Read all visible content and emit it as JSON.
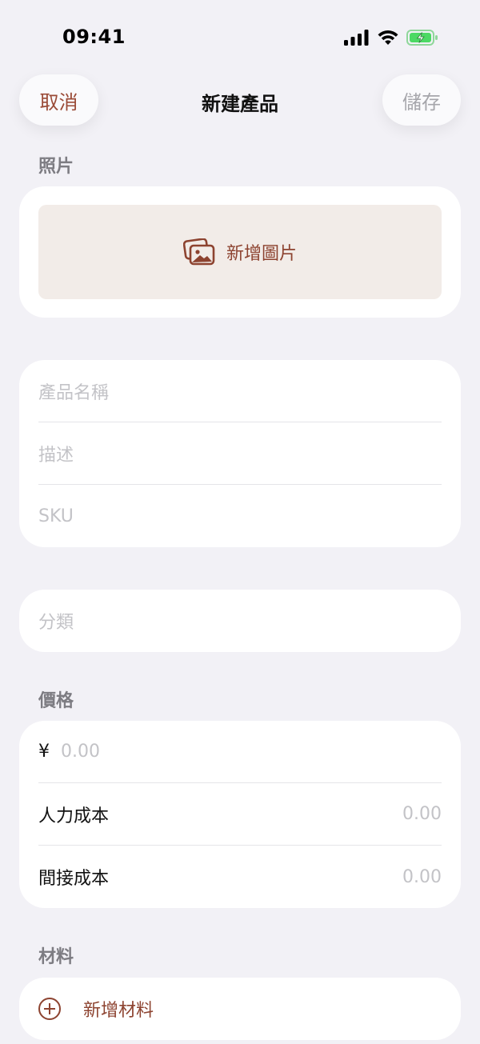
{
  "status_bar": {
    "time": "09:41",
    "icons": [
      "cellular-signal-icon",
      "wifi-icon",
      "battery-charging-icon"
    ]
  },
  "nav": {
    "cancel_label": "取消",
    "title": "新建產品",
    "save_label": "儲存"
  },
  "photos": {
    "section_label": "照片",
    "add_image_label": "新增圖片",
    "icon": "photo-stack-icon"
  },
  "info": {
    "name_placeholder": "產品名稱",
    "description_placeholder": "描述",
    "sku_placeholder": "SKU"
  },
  "category": {
    "placeholder": "分類"
  },
  "pricing": {
    "section_label": "價格",
    "currency_symbol": "¥",
    "price_placeholder": "0.00",
    "labor_cost_label": "人力成本",
    "labor_cost_value": "0.00",
    "overhead_cost_label": "間接成本",
    "overhead_cost_value": "0.00"
  },
  "materials": {
    "section_label": "材料",
    "add_label": "新增材料",
    "icon": "plus-circle-icon"
  },
  "colors": {
    "accent": "#8d4330",
    "background": "#f2f1f6",
    "card": "#ffffff",
    "placeholder": "#c3c3c7",
    "battery_green": "#4cd964"
  }
}
